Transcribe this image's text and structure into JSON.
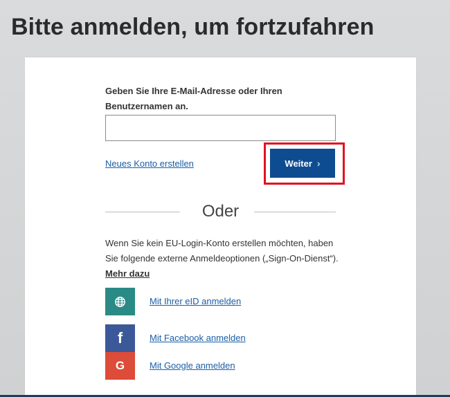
{
  "page": {
    "title": "Bitte anmelden, um fortzufahren"
  },
  "login": {
    "field_label": "Geben Sie Ihre E-Mail-Adresse oder Ihren Benutzernamen an.",
    "username_value": "",
    "new_account_link": "Neues Konto erstellen",
    "next_button": "Weiter",
    "next_button_icon": "chevron-right-icon",
    "next_button_chevron": "›",
    "highlight_color": "#e0121e"
  },
  "divider": {
    "text": "Oder"
  },
  "external": {
    "info_text": "Wenn Sie kein EU-Login-Konto erstellen möchten, haben Sie folgende externe Anmeldeoptionen („Sign-On-Dienst“).",
    "more_link": "Mehr dazu",
    "options": [
      {
        "label": "Mit Ihrer eID anmelden",
        "icon": "globe-icon",
        "icon_glyph": "",
        "color": "#2a8a86"
      },
      {
        "label": "Mit Facebook anmelden",
        "icon": "facebook-icon",
        "icon_glyph": "f",
        "color": "#3b5998"
      },
      {
        "label": "Mit Google anmelden",
        "icon": "google-icon",
        "icon_glyph": "G",
        "color": "#dd4b39"
      }
    ]
  },
  "colors": {
    "primary_button": "#0e4c92",
    "link": "#1a5ea6",
    "page_background": "#d6d8d9"
  }
}
